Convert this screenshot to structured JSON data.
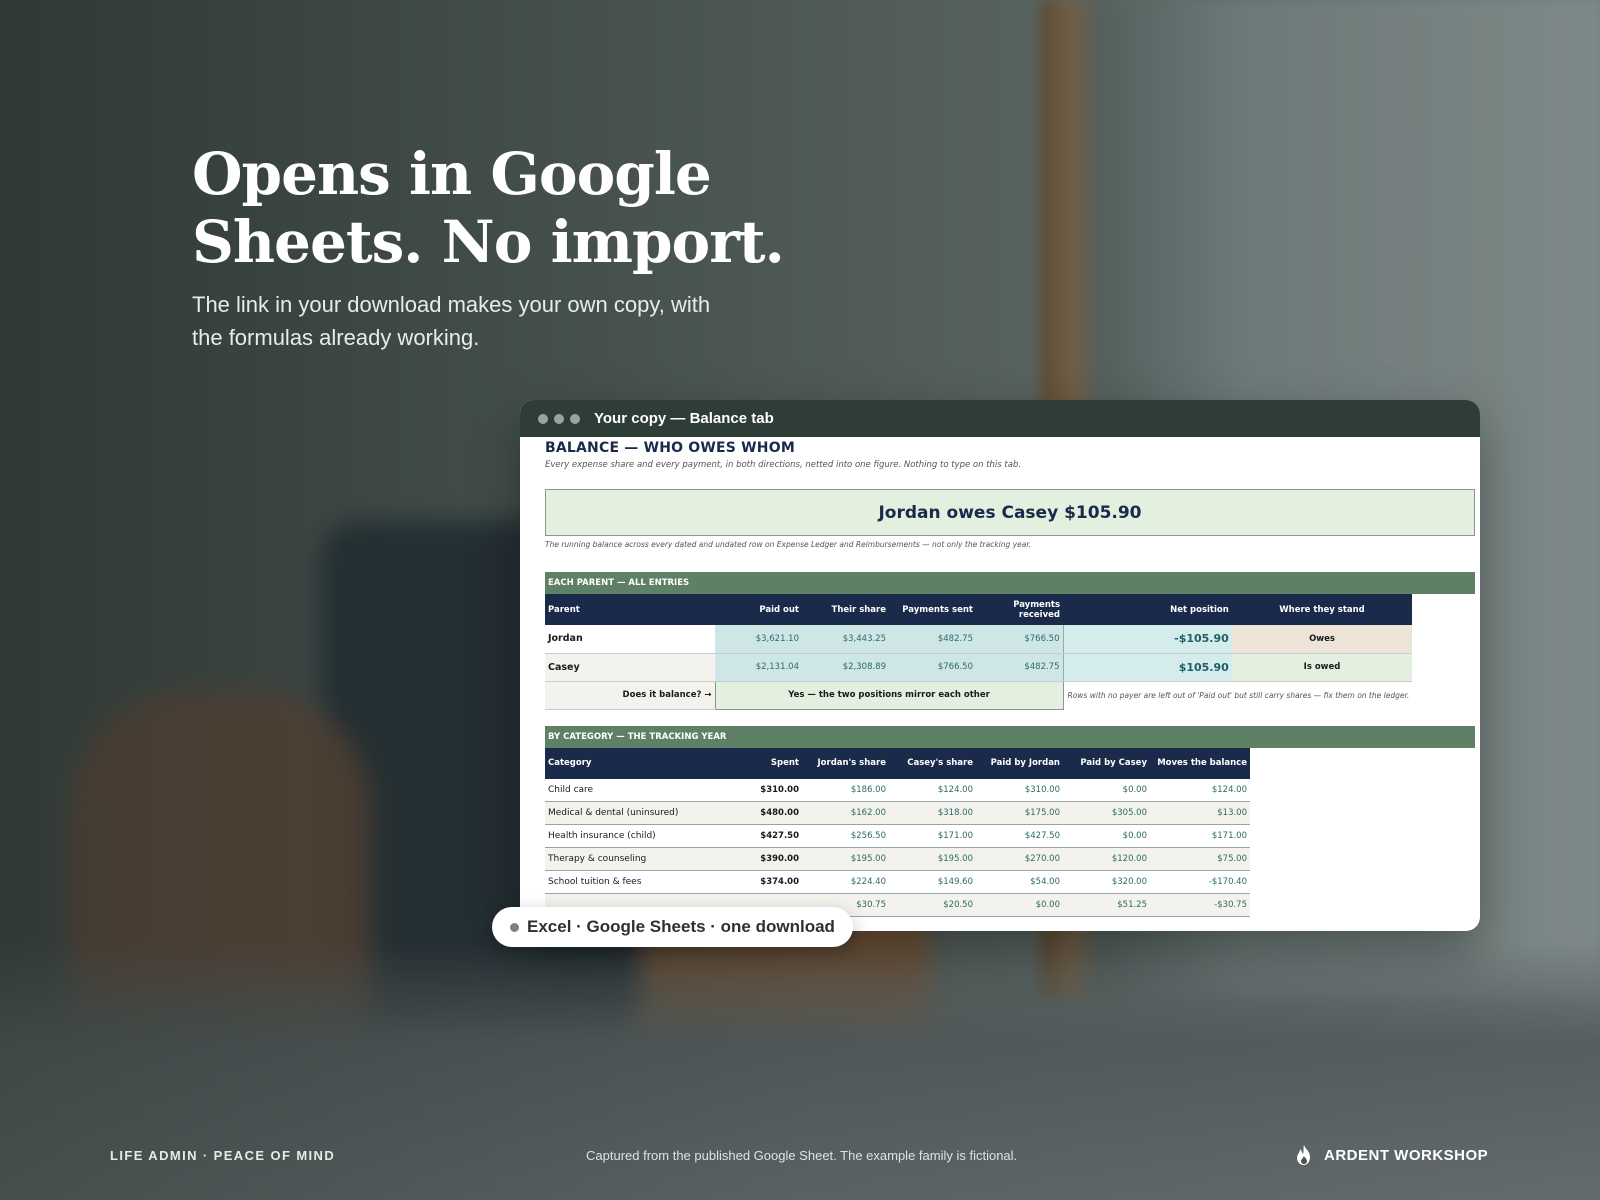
{
  "hero": {
    "headline": "Opens in Google Sheets. No import.",
    "subhead": "The link in your download makes your own copy, with the formulas already working."
  },
  "window": {
    "title": "Your copy — Balance tab"
  },
  "sheet": {
    "title": "BALANCE — WHO OWES WHOM",
    "subtitle": "Every expense share and every payment, in both directions, netted into one figure. Nothing to type on this tab.",
    "verdict": "Jordan owes Casey $105.90",
    "note": "The running balance across every dated and undated row on Expense Ledger and Reimbursements — not only the tracking year.",
    "section1": "EACH PARENT — ALL ENTRIES",
    "parent_headers": [
      "Parent",
      "Paid out",
      "Their share",
      "Payments sent",
      "Payments received",
      "Net position",
      "Where they stand"
    ],
    "parents": [
      {
        "name": "Jordan",
        "paid_out": "$3,621.10",
        "share": "$3,443.25",
        "sent": "$482.75",
        "received": "$766.50",
        "net": "-$105.90",
        "stand": "Owes"
      },
      {
        "name": "Casey",
        "paid_out": "$2,131.04",
        "share": "$2,308.89",
        "sent": "$766.50",
        "received": "$482.75",
        "net": "$105.90",
        "stand": "Is owed"
      }
    ],
    "balance_label": "Does it balance? →",
    "balance_value": "Yes — the two positions mirror each other",
    "balance_note": "Rows with no payer are left out of 'Paid out' but still carry shares — fix them on the ledger.",
    "section2": "BY CATEGORY — THE TRACKING YEAR",
    "category_headers": [
      "Category",
      "Spent",
      "Jordan's share",
      "Casey's share",
      "Paid by Jordan",
      "Paid by Casey",
      "Moves the balance"
    ],
    "categories": [
      {
        "name": "Child care",
        "spent": "$310.00",
        "jordan_share": "$186.00",
        "casey_share": "$124.00",
        "paid_jordan": "$310.00",
        "paid_casey": "$0.00",
        "moves": "$124.00"
      },
      {
        "name": "Medical & dental (uninsured)",
        "spent": "$480.00",
        "jordan_share": "$162.00",
        "casey_share": "$318.00",
        "paid_jordan": "$175.00",
        "paid_casey": "$305.00",
        "moves": "$13.00"
      },
      {
        "name": "Health insurance (child)",
        "spent": "$427.50",
        "jordan_share": "$256.50",
        "casey_share": "$171.00",
        "paid_jordan": "$427.50",
        "paid_casey": "$0.00",
        "moves": "$171.00"
      },
      {
        "name": "Therapy & counseling",
        "spent": "$390.00",
        "jordan_share": "$195.00",
        "casey_share": "$195.00",
        "paid_jordan": "$270.00",
        "paid_casey": "$120.00",
        "moves": "$75.00"
      },
      {
        "name": "School tuition & fees",
        "spent": "$374.00",
        "jordan_share": "$224.40",
        "casey_share": "$149.60",
        "paid_jordan": "$54.00",
        "paid_casey": "$320.00",
        "moves": "-$170.40"
      },
      {
        "name": "",
        "spent": "",
        "jordan_share": "$30.75",
        "casey_share": "$20.50",
        "paid_jordan": "$0.00",
        "paid_casey": "$51.25",
        "moves": "-$30.75"
      }
    ]
  },
  "pill": {
    "text": "Excel · Google Sheets · one download"
  },
  "footer": {
    "left": "LIFE ADMIN · PEACE OF MIND",
    "center": "Captured from the published Google Sheet. The example family is fictional.",
    "brand": "ARDENT WORKSHOP",
    "brand_icon": "flame-icon"
  }
}
